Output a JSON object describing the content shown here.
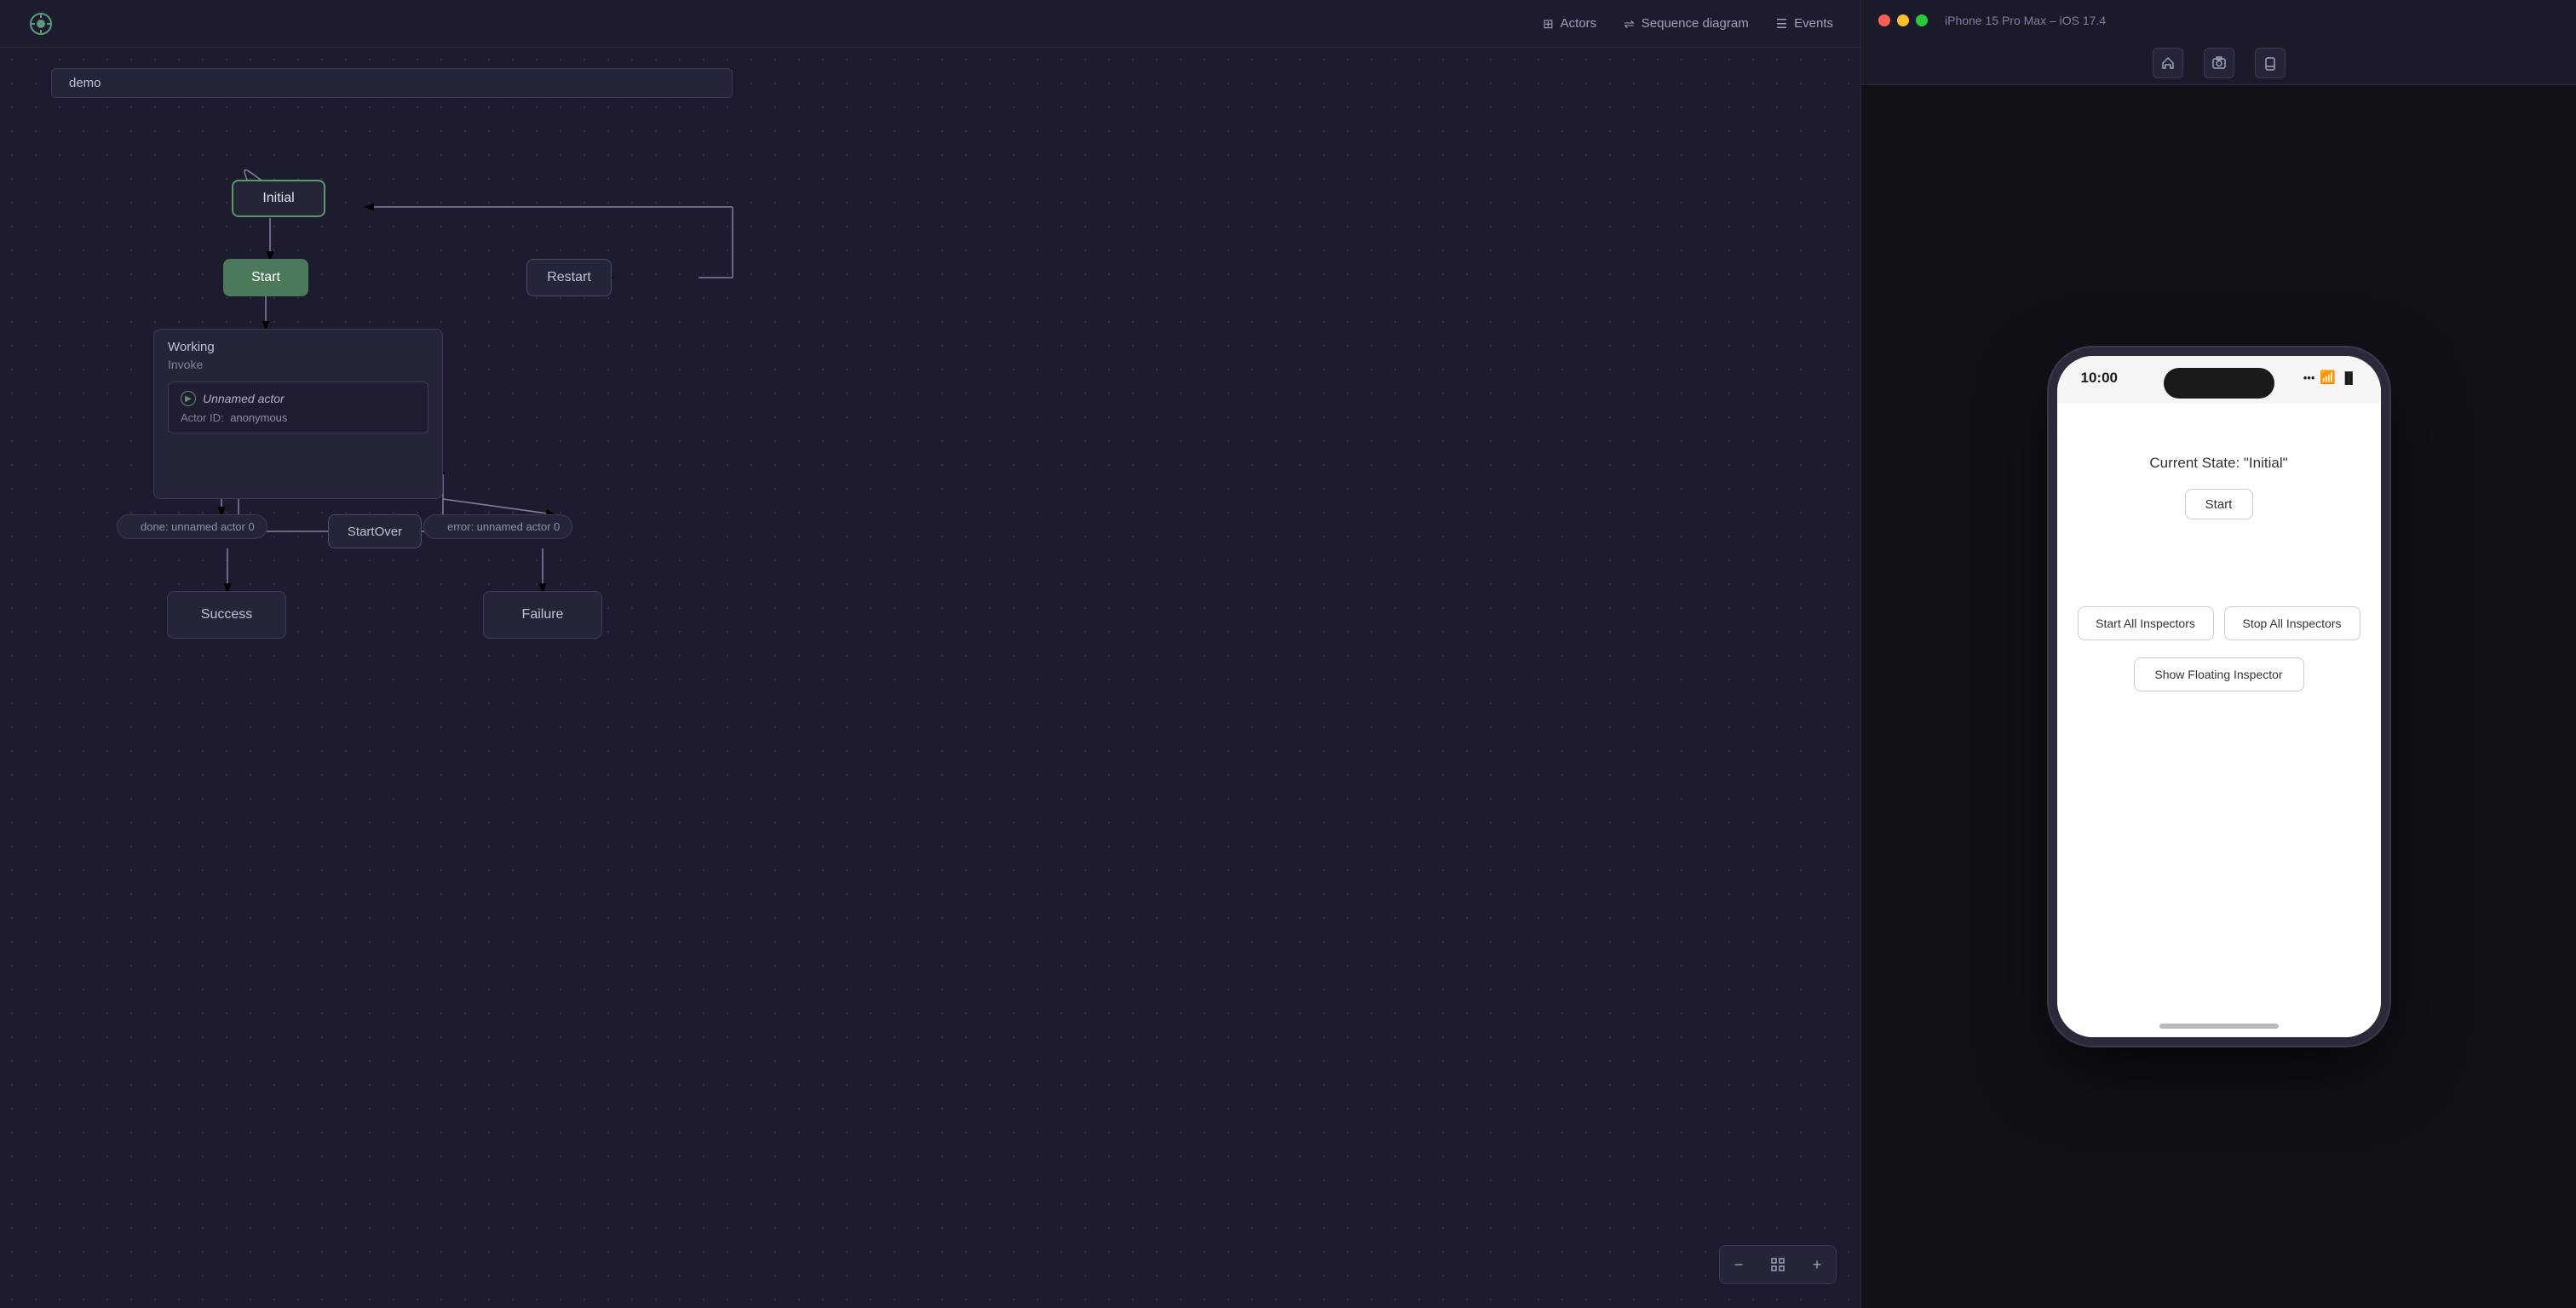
{
  "app": {
    "logo": "⊙"
  },
  "nav": {
    "actors_label": "Actors",
    "sequence_label": "Sequence diagram",
    "events_label": "Events"
  },
  "diagram": {
    "demo_label": "demo",
    "nodes": {
      "initial": "Initial",
      "start": "Start",
      "restart": "Restart",
      "working": "Working",
      "invoke_label": "Invoke",
      "actor_name": "Unnamed actor",
      "actor_id_key": "Actor ID:",
      "actor_id_val": "anonymous",
      "done_chip": "done:  unnamed actor 0",
      "startover": "StartOver",
      "error_chip": "error:  unnamed actor 0",
      "success": "Success",
      "failure": "Failure"
    },
    "zoom": {
      "zoom_out": "−",
      "fit": "⊡",
      "zoom_in": "+"
    }
  },
  "simulator": {
    "title": "iPhone 15 Pro Max – iOS 17.4",
    "time": "10:00",
    "status_icons": ".... ⦿ 📶",
    "current_state": "Current State: \"Initial\"",
    "start_btn": "Start",
    "start_all_inspectors": "Start All Inspectors",
    "stop_all_inspectors": "Stop All Inspectors",
    "show_floating_inspector": "Show Floating Inspector",
    "controls": {
      "home": "⌂",
      "screenshot": "📷",
      "rotate": "⟳"
    }
  }
}
